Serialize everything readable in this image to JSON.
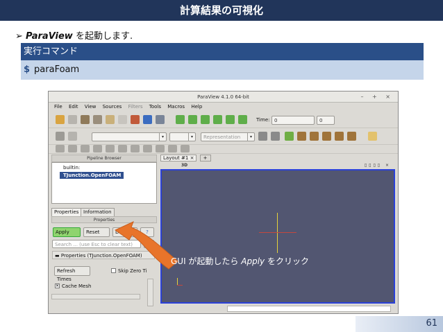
{
  "slide": {
    "title": "計算結果の可視化",
    "intro_bullet": "➢",
    "intro_app": "ParaView",
    "intro_rest": " を起動します.",
    "cmd_header": "実行コマンド",
    "cmd_prompt": "$",
    "cmd_text": "paraFoam",
    "page_number": "61"
  },
  "paraview": {
    "window_title": "ParaView 4.1.0 64-bit",
    "window_buttons": "– + ×",
    "menu": [
      "File",
      "Edit",
      "View",
      "Sources",
      "Filters",
      "Tools",
      "Macros",
      "Help"
    ],
    "time_label": "Time:",
    "time_value": "0",
    "time_step": "0",
    "representation_placeholder": "Representation",
    "pipeline_browser_title": "Pipeline Browser",
    "pipeline_items": [
      "builtin:",
      "TJunction.OpenFOAM"
    ],
    "tabs": [
      "Properties",
      "Information"
    ],
    "properties_title": "Properties",
    "apply_label": "Apply",
    "reset_label": "Reset",
    "delete_label": "Delete",
    "help_label": "?",
    "search_placeholder": "Search ... (use Esc to clear text)",
    "properties_section": "Properties (TJunction.OpenFOAM)",
    "refresh_label": "Refresh Times",
    "skip_zero_label": "Skip Zero Ti",
    "cache_mesh_label": "Cache Mesh",
    "layout_tab": "Layout #1 ×",
    "layout_add": "+",
    "view_mode": "3D"
  },
  "callout": {
    "prefix": "GUI が起動したら ",
    "app": "Apply",
    "suffix": " をクリック"
  },
  "colors": {
    "title_bg": "#21355a",
    "cmd_header_bg": "#2a4f88",
    "cmd_body_bg": "#c5d5ea",
    "view_bg": "#525671",
    "apply_green": "#35a839",
    "arrow_orange": "#e8742a"
  }
}
